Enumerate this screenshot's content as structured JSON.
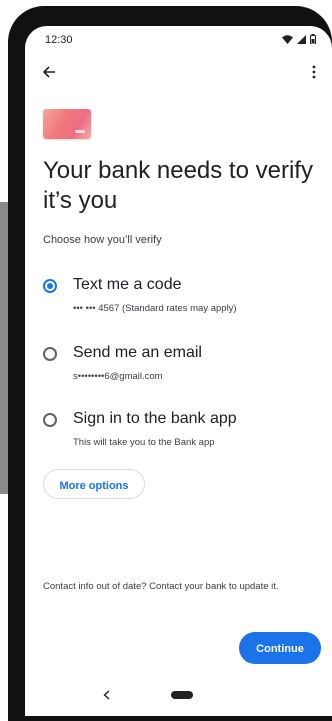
{
  "status_bar": {
    "time": "12:30"
  },
  "page": {
    "title": "Your bank needs to verify it’s you",
    "subtitle": "Choose how you’ll verify"
  },
  "options": [
    {
      "label": "Text me a code",
      "detail": "••• ••• 4567 (Standard rates may apply)",
      "selected": true
    },
    {
      "label": "Send me an email",
      "detail": "s••••••••6@gmail.com",
      "selected": false
    },
    {
      "label": "Sign in to the bank app",
      "detail": "This will take you to the Bank app",
      "selected": false
    }
  ],
  "more_options_label": "More options",
  "contact_note": "Contact info out of date? Contact your bank to update it.",
  "continue_label": "Continue",
  "colors": {
    "accent": "#1a73e8",
    "text": "#202124",
    "secondary_text": "#3c4043"
  },
  "icons": [
    "back-arrow-icon",
    "more-vert-icon",
    "wifi-icon",
    "signal-icon",
    "battery-icon",
    "nav-back-icon",
    "nav-home-icon"
  ]
}
